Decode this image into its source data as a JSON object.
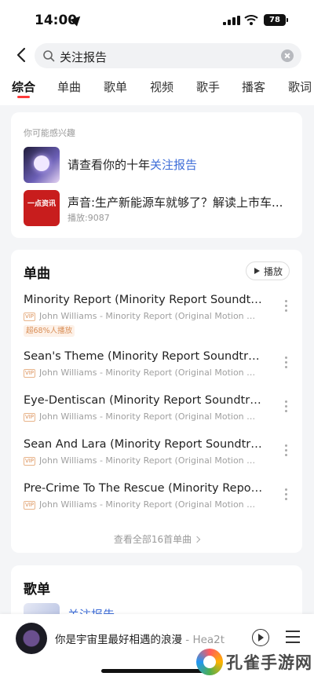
{
  "status_bar": {
    "time": "14:00",
    "battery": "78"
  },
  "search": {
    "query": "关注报告"
  },
  "tabs": [
    "综合",
    "单曲",
    "歌单",
    "视频",
    "歌手",
    "播客",
    "歌词"
  ],
  "suggestions": {
    "hint": "你可能感兴趣",
    "item1": {
      "prefix": "请查看你的十年",
      "link": "关注报告"
    },
    "item2": {
      "title": "声音:生产新能源车就够了？解读上市车...",
      "play_count": "播放:9087",
      "thumb_text": "一点资讯"
    }
  },
  "songs_section": {
    "title": "单曲",
    "play_label": "播放",
    "vip_label": "VIP",
    "items": [
      {
        "title": "Minority Report (Minority Report Soundtrack)",
        "sub": "John Williams - Minority Report (Original Motion Pic...",
        "tag": "超68%人播放"
      },
      {
        "title": "Sean's Theme (Minority Report Soundtrack)",
        "sub": "John Williams - Minority Report (Original Motion Pic..."
      },
      {
        "title": "Eye-Dentiscan (Minority Report Soundtrack)",
        "sub": "John Williams - Minority Report (Original Motion Pic..."
      },
      {
        "title": "Sean And Lara (Minority Report Soundtrack)",
        "sub": "John Williams - Minority Report (Original Motion Pic..."
      },
      {
        "title": "Pre-Crime To The Rescue (Minority Report...",
        "sub": "John Williams - Minority Report (Original Motion Pic..."
      }
    ],
    "view_all": "查看全部16首单曲"
  },
  "playlists_section": {
    "title": "歌单",
    "items": [
      {
        "title": "关注报告"
      }
    ]
  },
  "player": {
    "title": "你是宇宙里最好相遇的浪漫",
    "artist": " - Hea2t"
  },
  "watermark": {
    "text": "孔雀手游网"
  }
}
